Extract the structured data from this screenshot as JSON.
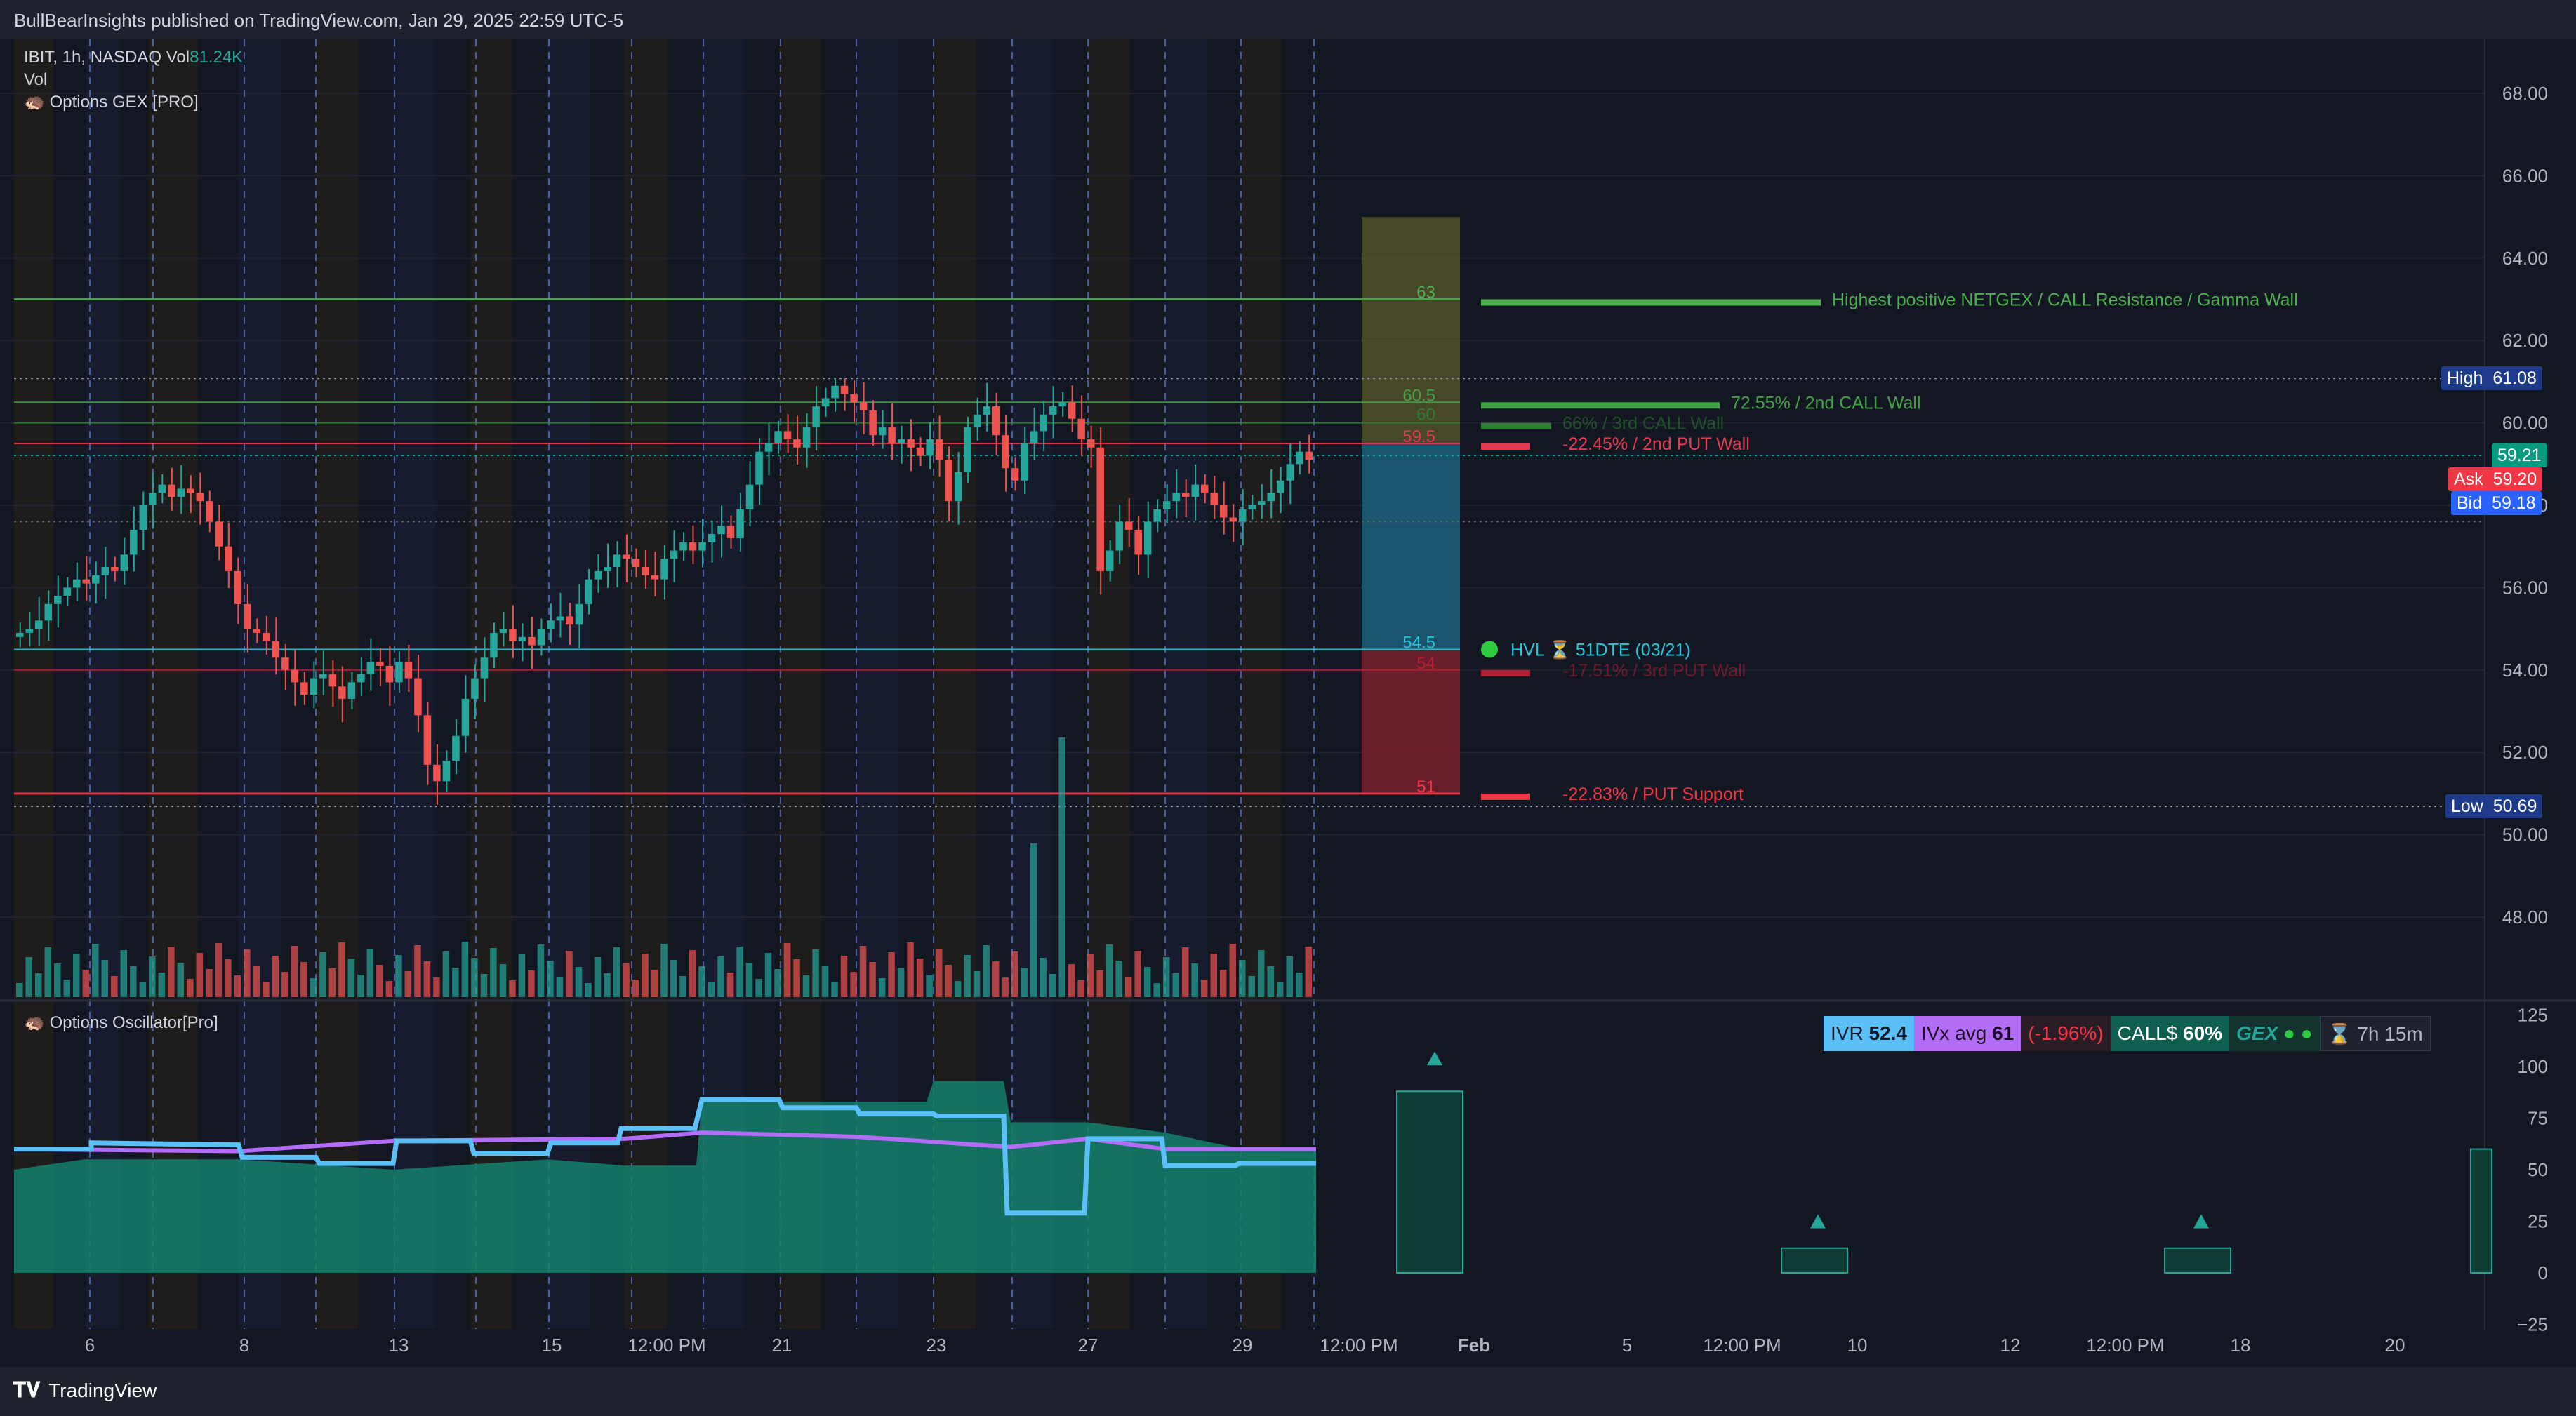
{
  "header": {
    "published_text": "BullBearInsights published on TradingView.com, Jan 29, 2025 22:59 UTC-5"
  },
  "footer": {
    "brand": "TradingView"
  },
  "legend": {
    "symbol": "IBIT, 1h, NASDAQ",
    "vol_label": "Vol",
    "vol_value": "81.24K",
    "vol_row": "Vol",
    "indicator": "Options GEX [PRO]",
    "oscillator": "Options Oscillator[Pro]"
  },
  "price_axis": {
    "ticks": [
      "68.00",
      "66.00",
      "64.00",
      "62.00",
      "60.00",
      "58.00",
      "56.00",
      "54.00",
      "52.00",
      "50.00",
      "48.00"
    ],
    "high_label": "High",
    "high_value": "61.08",
    "last_value": "59.21",
    "ask_label": "Ask",
    "ask_value": "59.20",
    "bid_label": "Bid",
    "bid_value": "59.18",
    "low_label": "Low",
    "low_value": "50.69"
  },
  "osc_axis": {
    "ticks": [
      "125",
      "100",
      "75",
      "50",
      "25",
      "0",
      "−25"
    ]
  },
  "time_axis": {
    "ticks": [
      "6",
      "8",
      "13",
      "15",
      "12:00 PM",
      "21",
      "23",
      "27",
      "29",
      "12:00 PM",
      "Feb",
      "5",
      "12:00 PM",
      "10",
      "12",
      "12:00 PM",
      "18",
      "20"
    ]
  },
  "levels": [
    {
      "price": 63,
      "label": "63",
      "text": "Highest positive NETGEX / CALL Resistance / Gamma Wall",
      "color": "#4caf50"
    },
    {
      "price": 60.5,
      "label": "60.5",
      "text": "72.55% / 2nd CALL Wall",
      "color": "#43a047"
    },
    {
      "price": 60,
      "label": "60",
      "text": "66% / 3rd CALL Wall",
      "color": "#2e7d32"
    },
    {
      "price": 59.5,
      "label": "59.5",
      "text": "-22.45% / 2nd PUT Wall",
      "color": "#e53950"
    },
    {
      "price": 54.5,
      "label": "54.5",
      "text": "HVL ⏳ 51DTE (03/21)",
      "color": "#26c6da"
    },
    {
      "price": 54,
      "label": "54",
      "text": "-17.51% / 3rd PUT Wall",
      "color": "#b71c34"
    },
    {
      "price": 51,
      "label": "51",
      "text": "-22.83% / PUT Support",
      "color": "#f23645"
    }
  ],
  "osc_stats": {
    "ivr_label": "IVR",
    "ivr_value": "52.4",
    "ivx_label": "IVx avg",
    "ivx_value": "61",
    "change": "(-1.96%)",
    "call_label": "CALL$",
    "call_value": "60%",
    "gex_label": "GEX",
    "time_left": "7h 15m"
  },
  "colors": {
    "bull": "#26a69a",
    "bear": "#ef5350",
    "bg": "#131722",
    "ivr": "#5bc0f8",
    "ivx": "#b36cf5"
  },
  "chart_data": {
    "type": "candlestick",
    "symbol": "IBIT",
    "interval": "1h",
    "ylim": [
      46.5,
      69.5
    ],
    "high": 61.08,
    "low": 50.69,
    "last": 59.21,
    "closes": [
      54.9,
      55.0,
      55.2,
      55.6,
      55.8,
      56.0,
      56.2,
      56.1,
      56.3,
      56.5,
      56.4,
      56.8,
      57.4,
      58.0,
      58.3,
      58.5,
      58.2,
      58.4,
      58.3,
      58.1,
      57.6,
      57.0,
      56.4,
      55.6,
      55.0,
      54.9,
      54.7,
      54.3,
      54.0,
      53.7,
      53.4,
      53.8,
      53.9,
      53.6,
      53.3,
      53.7,
      53.9,
      54.2,
      54.1,
      53.7,
      54.2,
      53.8,
      52.9,
      51.7,
      51.3,
      51.8,
      52.4,
      53.3,
      53.8,
      54.3,
      54.9,
      55.0,
      54.7,
      54.8,
      54.6,
      55.0,
      55.2,
      55.3,
      55.1,
      55.6,
      56.2,
      56.4,
      56.5,
      56.8,
      56.7,
      56.5,
      56.3,
      56.2,
      56.7,
      56.9,
      57.1,
      56.9,
      57.1,
      57.3,
      57.5,
      57.2,
      57.9,
      58.5,
      59.3,
      59.5,
      59.8,
      59.6,
      59.4,
      59.9,
      60.4,
      60.6,
      60.9,
      60.7,
      60.5,
      60.3,
      59.7,
      59.9,
      59.5,
      59.6,
      59.4,
      59.2,
      59.6,
      59.1,
      58.1,
      58.8,
      59.9,
      60.2,
      60.4,
      59.7,
      58.9,
      58.6,
      59.5,
      59.8,
      60.2,
      60.4,
      60.5,
      60.1,
      59.6,
      59.4,
      56.4,
      56.9,
      57.6,
      57.4,
      56.8,
      57.6,
      57.9,
      58.1,
      58.3,
      58.2,
      58.5,
      58.3,
      58.0,
      57.7,
      57.6,
      57.9,
      58.0,
      58.1,
      58.3,
      58.6,
      59.0,
      59.3,
      59.1
    ]
  }
}
